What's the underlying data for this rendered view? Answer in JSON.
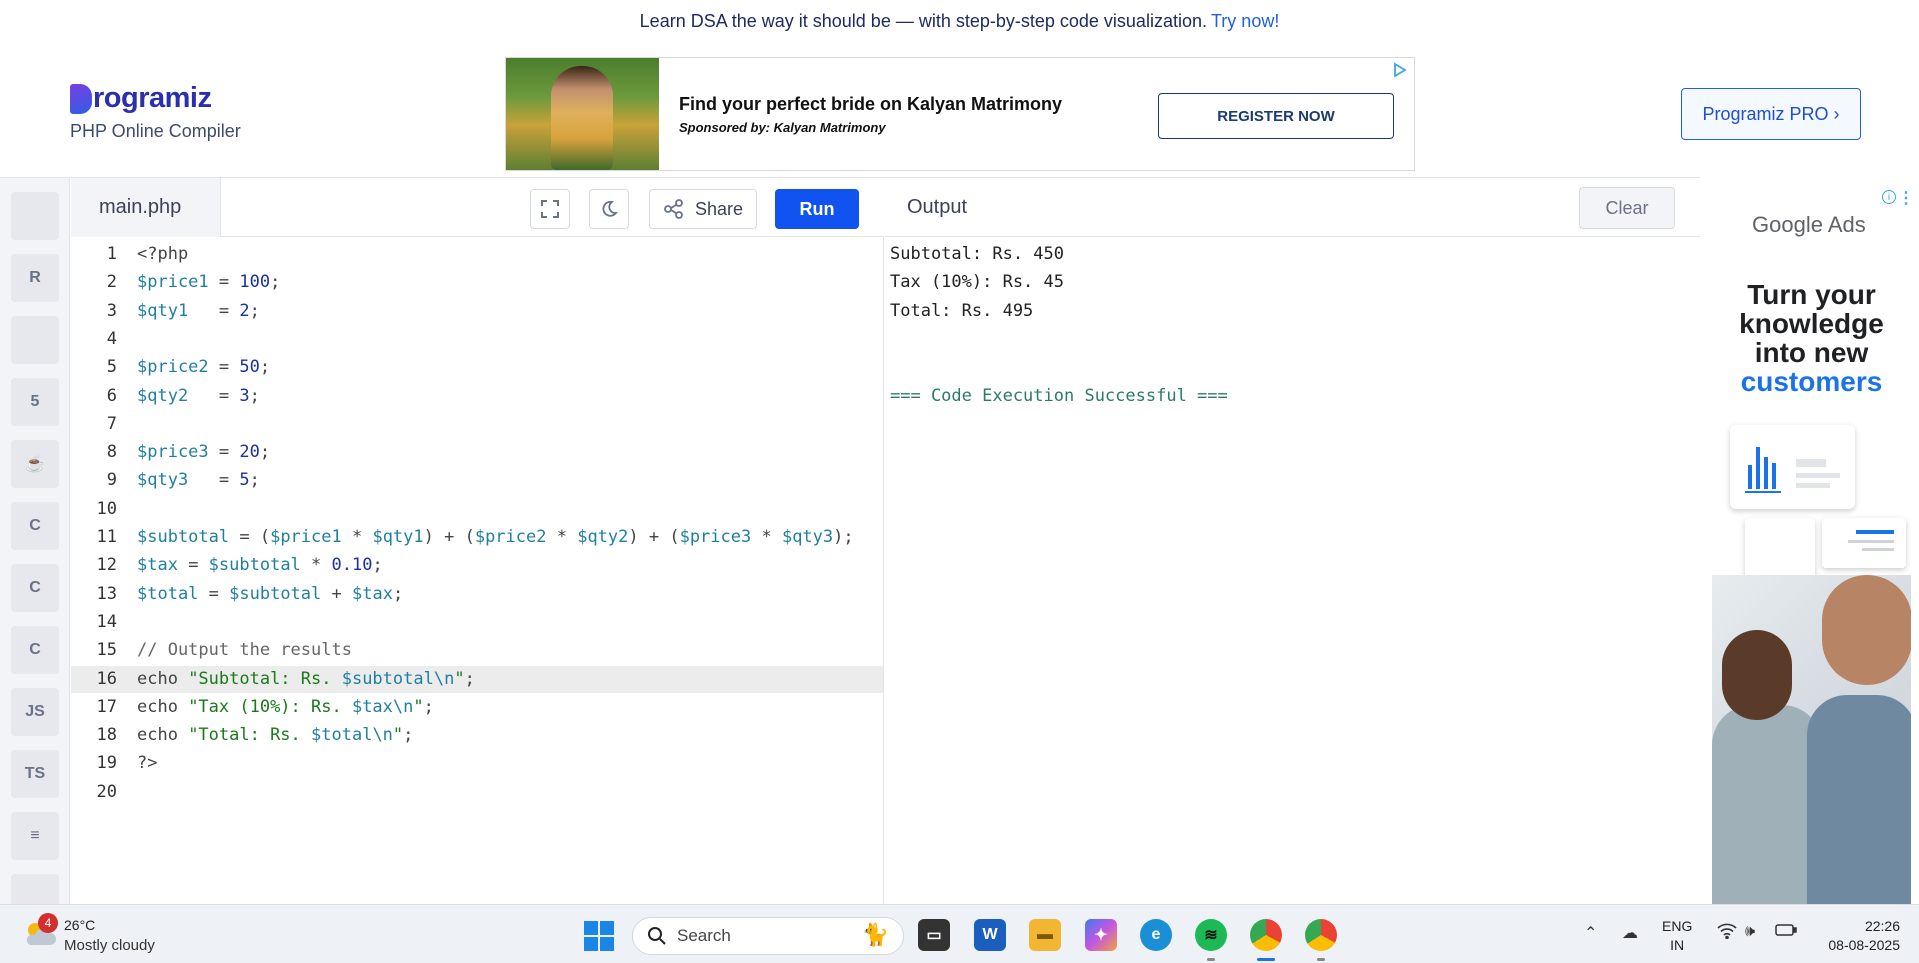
{
  "banner": {
    "text": "Learn DSA the way it should be — with step-by-step code visualization.",
    "cta": "Try now!"
  },
  "header": {
    "logo_text": "rogramiz",
    "subtitle": "PHP Online Compiler",
    "pro_button": "Programiz PRO ›"
  },
  "ad": {
    "title": "Find your perfect bride on Kalyan Matrimony",
    "sponsor": "Sponsored by: Kalyan Matrimony",
    "button": "REGISTER NOW"
  },
  "sidebar": {
    "items": [
      {
        "icon": "python-icon",
        "label": ""
      },
      {
        "icon": "r-lang-icon",
        "label": "R"
      },
      {
        "icon": "database-icon",
        "label": ""
      },
      {
        "icon": "html5-icon",
        "label": "5"
      },
      {
        "icon": "java-icon",
        "label": "☕"
      },
      {
        "icon": "c-icon",
        "label": "C"
      },
      {
        "icon": "cpp-icon",
        "label": "C"
      },
      {
        "icon": "csharp-icon",
        "label": "C"
      },
      {
        "icon": "js-icon",
        "label": "JS"
      },
      {
        "icon": "ts-icon",
        "label": "TS"
      },
      {
        "icon": "stack-icon",
        "label": "≡"
      },
      {
        "icon": "swift-icon",
        "label": ""
      }
    ]
  },
  "editor": {
    "file_name": "main.php",
    "share_label": "Share",
    "run_label": "Run",
    "active_line": 16,
    "lines": [
      {
        "n": "1",
        "t": "<?php"
      },
      {
        "n": "2",
        "t": "$price1 = 100;"
      },
      {
        "n": "3",
        "t": "$qty1   = 2;"
      },
      {
        "n": "4",
        "t": ""
      },
      {
        "n": "5",
        "t": "$price2 = 50;"
      },
      {
        "n": "6",
        "t": "$qty2   = 3;"
      },
      {
        "n": "7",
        "t": ""
      },
      {
        "n": "8",
        "t": "$price3 = 20;"
      },
      {
        "n": "9",
        "t": "$qty3   = 5;"
      },
      {
        "n": "10",
        "t": ""
      },
      {
        "n": "11",
        "t": "$subtotal = ($price1 * $qty1) + ($price2 * $qty2) + ($price3 * $qty3);"
      },
      {
        "n": "12",
        "t": "$tax = $subtotal * 0.10;"
      },
      {
        "n": "13",
        "t": "$total = $subtotal + $tax;"
      },
      {
        "n": "14",
        "t": ""
      },
      {
        "n": "15",
        "t": "// Output the results"
      },
      {
        "n": "16",
        "t": "echo \"Subtotal: Rs. $subtotal\\n\";"
      },
      {
        "n": "17",
        "t": "echo \"Tax (10%): Rs. $tax\\n\";"
      },
      {
        "n": "18",
        "t": "echo \"Total: Rs. $total\\n\";"
      },
      {
        "n": "19",
        "t": "?>"
      },
      {
        "n": "20",
        "t": ""
      }
    ]
  },
  "output": {
    "title": "Output",
    "clear_label": "Clear",
    "lines": [
      "Subtotal: Rs. 450",
      "Tax (10%): Rs. 45",
      "Total: Rs. 495",
      "",
      "",
      "=== Code Execution Successful ==="
    ]
  },
  "google_ad": {
    "brand": "Google Ads",
    "headline_1": "Turn your knowledge into new",
    "headline_2": "customers"
  },
  "taskbar": {
    "weather_badge": "4",
    "temperature": "26°C",
    "condition": "Mostly cloudy",
    "search_placeholder": "Search",
    "lang_line1": "ENG",
    "lang_line2": "IN",
    "time": "22:26",
    "date": "08-08-2025"
  },
  "colors": {
    "accent": "#1053f0",
    "brand": "#2a2fb0",
    "success_text": "#2c7a6a"
  }
}
